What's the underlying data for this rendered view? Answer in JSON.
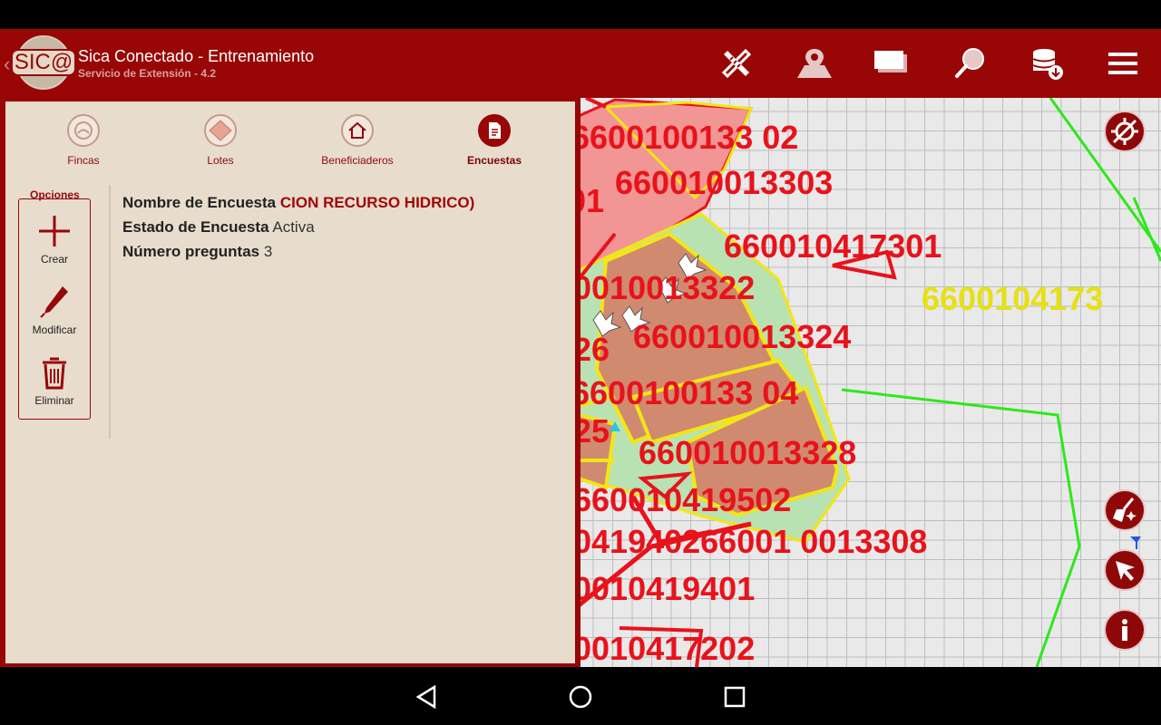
{
  "app": {
    "title": "Sica Conectado - Entrenamiento",
    "subtitle": "Servicio de Extensión - 4.2",
    "logo_text": "SIC@"
  },
  "toolbar": {
    "icons": [
      "measure-tools-icon",
      "map-pin-icon",
      "layers-icon",
      "search-icon",
      "database-download-icon",
      "hamburger-menu-icon"
    ]
  },
  "tabs": [
    {
      "label": "Fincas",
      "icon": "farm-icon",
      "active": false
    },
    {
      "label": "Lotes",
      "icon": "plot-icon",
      "active": false
    },
    {
      "label": "Beneficiaderos",
      "icon": "house-icon",
      "active": false
    },
    {
      "label": "Encuestas",
      "icon": "document-icon",
      "active": true
    }
  ],
  "options": {
    "title": "Opciones",
    "create": "Crear",
    "modify": "Modificar",
    "delete": "Eliminar"
  },
  "survey": {
    "name_label": "Nombre de Encuesta",
    "name_value": "CION RECURSO HIDRICO)",
    "state_label": "Estado de Encuesta",
    "state_value": "Activa",
    "questions_label": "Número preguntas",
    "questions_value": "3"
  },
  "map": {
    "labels": [
      {
        "text": "6600100133 02"
      },
      {
        "text": "660010013303"
      },
      {
        "text": "01"
      },
      {
        "text": "660010417301"
      },
      {
        "text": "6600104173"
      },
      {
        "text": "0010013322"
      },
      {
        "text": "26"
      },
      {
        "text": "660010013324"
      },
      {
        "text": "6600100133 04"
      },
      {
        "text": "25"
      },
      {
        "text": "660010013328"
      },
      {
        "text": "660010419502"
      },
      {
        "text": "041940266001 0013308"
      },
      {
        "text": "0010419401"
      },
      {
        "text": "0010417202"
      }
    ],
    "colors": {
      "grid": "#bdbdbd",
      "background": "#e9e9e9",
      "label_red": "#e8121b",
      "label_yellow": "#e7e014",
      "boundary_green": "#2de81a"
    },
    "right_buttons": [
      "no-location-icon",
      "clear-broom-icon",
      "pointer-icon",
      "info-icon"
    ]
  },
  "system_nav": [
    "back-icon",
    "home-icon",
    "recents-icon"
  ],
  "colors": {
    "brand": "#980606",
    "panel_bg": "#e8dccd"
  }
}
